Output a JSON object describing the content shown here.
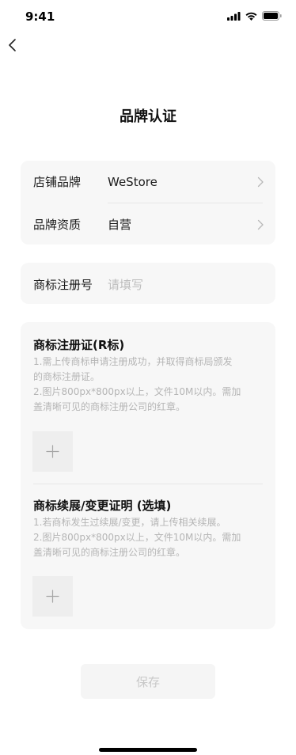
{
  "status_bar": {
    "time": "9:41"
  },
  "header": {
    "title": "品牌认证"
  },
  "brand_card": {
    "rows": [
      {
        "label": "店铺品牌",
        "value": "WeStore"
      },
      {
        "label": "品牌资质",
        "value": "自营"
      }
    ]
  },
  "trademark_number": {
    "label": "商标注册号",
    "placeholder": "请填写"
  },
  "upload_sections": [
    {
      "title": "商标注册证(R标)",
      "desc_lines": [
        "1.需上传商标申请注册成功，并取得商标局颁发",
        "的商标注册证。",
        "2.图片800px*800px以上，文件10M以内。需加",
        "盖清晰可见的商标注册公司的红章。"
      ]
    },
    {
      "title": "商标续展/变更证明 (选填)",
      "desc_lines": [
        "1.若商标发生过续展/变更，请上传相关续展。",
        "2.图片800px*800px以上，文件10M以内。需加",
        "盖清晰可见的商标注册公司的红章。"
      ]
    }
  ],
  "footer": {
    "save_label": "保存"
  },
  "icons": {
    "back": "chevron-left-icon",
    "row_arrow": "chevron-right-icon",
    "upload": "plus-icon",
    "signal": "signal-icon",
    "wifi": "wifi-icon",
    "battery": "battery-icon"
  },
  "colors": {
    "card_bg": "#f7f7f7",
    "placeholder": "#bdbdbd",
    "hint_text": "#b5b5b5",
    "disabled_button_bg": "#f5f5f5",
    "disabled_button_text": "#c8c8c8"
  }
}
